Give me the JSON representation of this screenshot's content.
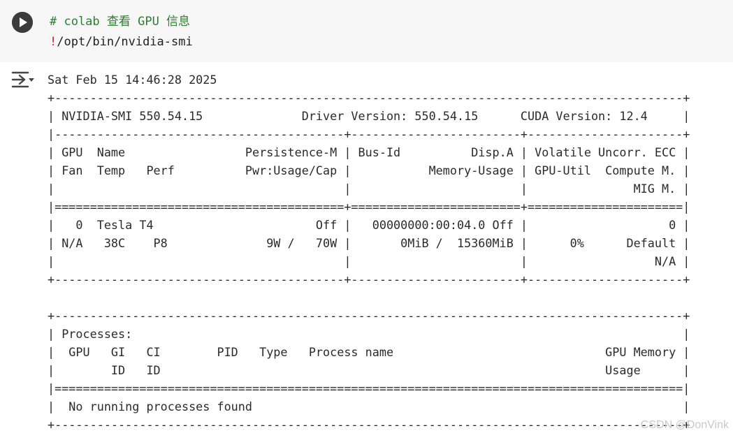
{
  "code_cell": {
    "comment_line": "# colab 查看 GPU 信息",
    "command_bang": "!",
    "command_rest": "/opt/bin/nvidia-smi",
    "run_icon": "play-circle-icon"
  },
  "output": {
    "toggle_icon": "output-collapse-icon",
    "lines": [
      "Sat Feb 15 14:46:28 2025",
      "+-----------------------------------------------------------------------------------------+",
      "| NVIDIA-SMI 550.54.15              Driver Version: 550.54.15      CUDA Version: 12.4     |",
      "|-----------------------------------------+------------------------+----------------------+",
      "| GPU  Name                 Persistence-M | Bus-Id          Disp.A | Volatile Uncorr. ECC |",
      "| Fan  Temp   Perf          Pwr:Usage/Cap |           Memory-Usage | GPU-Util  Compute M. |",
      "|                                         |                        |               MIG M. |",
      "|=========================================+========================+======================|",
      "|   0  Tesla T4                       Off |   00000000:00:04.0 Off |                    0 |",
      "| N/A   38C    P8              9W /   70W |       0MiB /  15360MiB |      0%      Default |",
      "|                                         |                        |                  N/A |",
      "+-----------------------------------------+------------------------+----------------------+",
      "",
      "+-----------------------------------------------------------------------------------------+",
      "| Processes:                                                                              |",
      "|  GPU   GI   CI        PID   Type   Process name                              GPU Memory |",
      "|        ID   ID                                                               Usage      |",
      "|=========================================================================================|",
      "|  No running processes found                                                             |",
      "+-----------------------------------------------------------------------------------------+"
    ]
  },
  "watermark": "CSDN @DonVink"
}
